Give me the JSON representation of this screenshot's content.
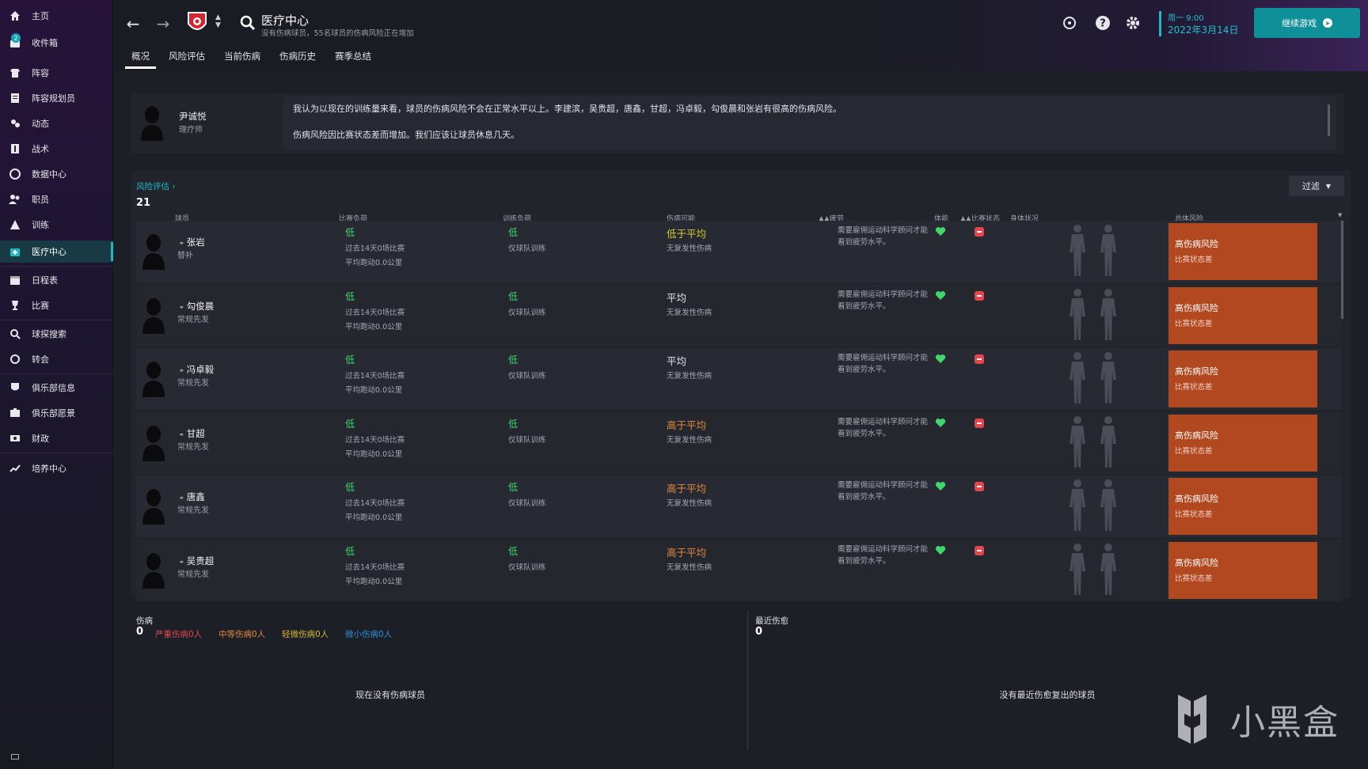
{
  "sidebar": {
    "items": [
      {
        "label": "主页",
        "icon": "home-icon"
      },
      {
        "label": "收件箱",
        "icon": "inbox-icon",
        "badge": "2"
      },
      {
        "label": "阵容",
        "icon": "squad-icon"
      },
      {
        "label": "阵容规划员",
        "icon": "squad-planner-icon"
      },
      {
        "label": "动态",
        "icon": "dynamics-icon"
      },
      {
        "label": "战术",
        "icon": "tactics-icon"
      },
      {
        "label": "数据中心",
        "icon": "data-hub-icon"
      },
      {
        "label": "职员",
        "icon": "staff-icon"
      },
      {
        "label": "训练",
        "icon": "training-icon"
      },
      {
        "label": "医疗中心",
        "icon": "medical-icon"
      },
      {
        "label": "日程表",
        "icon": "calendar-icon"
      },
      {
        "label": "比赛",
        "icon": "trophy-icon"
      },
      {
        "label": "球探搜索",
        "icon": "scouting-icon"
      },
      {
        "label": "转会",
        "icon": "transfers-icon"
      },
      {
        "label": "俱乐部信息",
        "icon": "club-info-icon"
      },
      {
        "label": "俱乐部愿景",
        "icon": "club-vision-icon"
      },
      {
        "label": "财政",
        "icon": "finances-icon"
      },
      {
        "label": "培养中心",
        "icon": "development-icon"
      }
    ],
    "active_index": 9
  },
  "header": {
    "title": "医疗中心",
    "subtitle": "没有伤病球员，55名球员的伤病风险正在增加",
    "tabs": [
      "概况",
      "风险评估",
      "当前伤病",
      "伤病历史",
      "赛季总结"
    ],
    "active_tab": 0,
    "date_day": "周一 9:00",
    "date_full": "2022年3月14日",
    "continue_label": "继续游戏",
    "accent_color": "#1fb8c4"
  },
  "advice": {
    "staff_name": "尹诚悦",
    "staff_role": "理疗师",
    "lines": [
      "我认为以现在的训练量来看，球员的伤病风险不会在正常水平以上。李建滨，吴贵超，唐鑫，甘超，冯卓毅，勾俊晨和张岩有很高的伤病风险。",
      "伤病风险因比赛状态差而增加。我们应该让球员休息几天。"
    ]
  },
  "risk_table": {
    "link_label": "风险评估 ›",
    "count": "21",
    "filter_label": "过滤",
    "columns": {
      "player": "球员",
      "match_load": "比赛负荷",
      "training_load": "训练负荷",
      "injury_prone": "伤病可能",
      "fatigue": "▲▲疲劳",
      "condition": "体能",
      "match_sharpness": "▲▲比赛状态",
      "body": "身体状况",
      "overall_risk": "总体风险"
    },
    "rows": [
      {
        "name": "张岩",
        "role": "替补",
        "match_load": "低",
        "match_sub1": "过去14天0场比赛",
        "match_sub2": "平均跑动0.0公里",
        "training_load": "低",
        "training_sub": "仅球队训练",
        "injury": "低于平均",
        "injury_color": "#d6c935",
        "injury_sub": "无复发性伤病",
        "fatigue": "需要雇佣运动科学顾问才能看到疲劳水平。",
        "risk": "高伤病风险",
        "risk_sub": "比赛状态差"
      },
      {
        "name": "勾俊晨",
        "role": "常规先发",
        "match_load": "低",
        "match_sub1": "过去14天0场比赛",
        "match_sub2": "平均跑动0.0公里",
        "training_load": "低",
        "training_sub": "仅球队训练",
        "injury": "平均",
        "injury_color": "#e6e6ea",
        "injury_sub": "无复发性伤病",
        "fatigue": "需要雇佣运动科学顾问才能看到疲劳水平。",
        "risk": "高伤病风险",
        "risk_sub": "比赛状态差"
      },
      {
        "name": "冯卓毅",
        "role": "常规先发",
        "match_load": "低",
        "match_sub1": "过去14天0场比赛",
        "match_sub2": "平均跑动0.0公里",
        "training_load": "低",
        "training_sub": "仅球队训练",
        "injury": "平均",
        "injury_color": "#e6e6ea",
        "injury_sub": "无复发性伤病",
        "fatigue": "需要雇佣运动科学顾问才能看到疲劳水平。",
        "risk": "高伤病风险",
        "risk_sub": "比赛状态差"
      },
      {
        "name": "甘超",
        "role": "常规先发",
        "match_load": "低",
        "match_sub1": "过去14天0场比赛",
        "match_sub2": "平均跑动0.0公里",
        "training_load": "低",
        "training_sub": "仅球队训练",
        "injury": "高于平均",
        "injury_color": "#e08a3a",
        "injury_sub": "无复发性伤病",
        "fatigue": "需要雇佣运动科学顾问才能看到疲劳水平。",
        "risk": "高伤病风险",
        "risk_sub": "比赛状态差"
      },
      {
        "name": "唐鑫",
        "role": "常规先发",
        "match_load": "低",
        "match_sub1": "过去14天0场比赛",
        "match_sub2": "平均跑动0.0公里",
        "training_load": "低",
        "training_sub": "仅球队训练",
        "injury": "高于平均",
        "injury_color": "#e08a3a",
        "injury_sub": "无复发性伤病",
        "fatigue": "需要雇佣运动科学顾问才能看到疲劳水平。",
        "risk": "高伤病风险",
        "risk_sub": "比赛状态差"
      },
      {
        "name": "吴贵超",
        "role": "常规先发",
        "match_load": "低",
        "match_sub1": "过去14天0场比赛",
        "match_sub2": "平均跑动0.0公里",
        "training_load": "低",
        "training_sub": "仅球队训练",
        "injury": "高于平均",
        "injury_color": "#e08a3a",
        "injury_sub": "无复发性伤病",
        "fatigue": "需要雇佣运动科学顾问才能看到疲劳水平。",
        "risk": "高伤病风险",
        "risk_sub": "比赛状态差"
      }
    ]
  },
  "injuries": {
    "title": "伤病",
    "count": "0",
    "severe": "严重伤病0人",
    "moderate": "中等伤病0人",
    "minor": "轻微伤病0人",
    "slight": "微小伤病0人",
    "empty": "现在没有伤病球员",
    "colors": {
      "severe": "#e2474d",
      "moderate": "#e08a3a",
      "minor": "#d6b735",
      "slight": "#2f8fd6"
    }
  },
  "recent": {
    "title": "最近伤愈",
    "count": "0",
    "empty": "没有最近伤愈复出的球员"
  },
  "watermark": {
    "text": "小黑盒"
  }
}
